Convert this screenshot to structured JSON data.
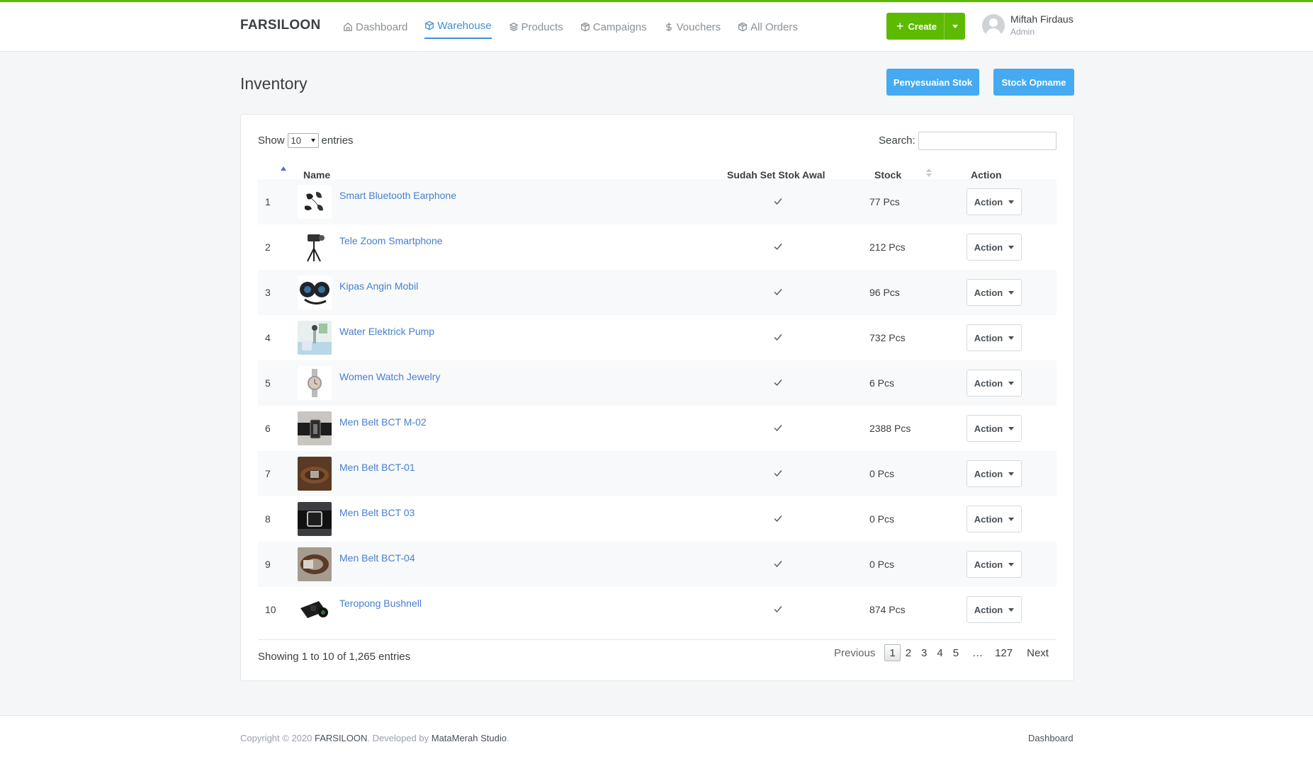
{
  "brand": "FARSILOON",
  "nav": [
    {
      "label": "Dashboard",
      "icon": "home-icon",
      "active": false
    },
    {
      "label": "Warehouse",
      "icon": "box-icon",
      "active": true
    },
    {
      "label": "Products",
      "icon": "layers-icon",
      "active": false
    },
    {
      "label": "Campaigns",
      "icon": "package-icon",
      "active": false
    },
    {
      "label": "Vouchers",
      "icon": "dollar-icon",
      "active": false
    },
    {
      "label": "All Orders",
      "icon": "package-icon",
      "active": false
    }
  ],
  "header": {
    "create_label": "Create",
    "user_name": "Miftah Firdaus",
    "user_role": "Admin"
  },
  "page": {
    "title": "Inventory",
    "btn_adjust": "Penyesuaian Stok",
    "btn_opname": "Stock Opname"
  },
  "table": {
    "show_label": "Show",
    "entries_value": "10",
    "entries_label": "entries",
    "search_label": "Search:",
    "search_value": "",
    "columns": {
      "name": "Name",
      "stok_awal": "Sudah Set Stok Awal",
      "stock": "Stock",
      "action": "Action"
    },
    "rows": [
      {
        "no": "1",
        "name": "Smart Bluetooth Earphone",
        "stock": "77 Pcs",
        "action": "Action"
      },
      {
        "no": "2",
        "name": "Tele Zoom Smartphone",
        "stock": "212 Pcs",
        "action": "Action"
      },
      {
        "no": "3",
        "name": "Kipas Angin Mobil",
        "stock": "96 Pcs",
        "action": "Action"
      },
      {
        "no": "4",
        "name": "Water Elektrick Pump",
        "stock": "732 Pcs",
        "action": "Action"
      },
      {
        "no": "5",
        "name": "Women Watch Jewelry",
        "stock": "6 Pcs",
        "action": "Action"
      },
      {
        "no": "6",
        "name": "Men Belt BCT M-02",
        "stock": "2388 Pcs",
        "action": "Action"
      },
      {
        "no": "7",
        "name": "Men Belt BCT-01",
        "stock": "0 Pcs",
        "action": "Action"
      },
      {
        "no": "8",
        "name": "Men Belt BCT 03",
        "stock": "0 Pcs",
        "action": "Action"
      },
      {
        "no": "9",
        "name": "Men Belt BCT-04",
        "stock": "0 Pcs",
        "action": "Action"
      },
      {
        "no": "10",
        "name": "Teropong Bushnell",
        "stock": "874 Pcs",
        "action": "Action"
      }
    ],
    "showing_text": "Showing 1 to 10 of 1,265 entries",
    "pagination": {
      "previous": "Previous",
      "pages": [
        "1",
        "2",
        "3",
        "4",
        "5"
      ],
      "ellipsis": "…",
      "last": "127",
      "next": "Next"
    }
  },
  "footer": {
    "copy_prefix": "Copyright © 2020 ",
    "copy_brand": "FARSILOON",
    "copy_mid": ". Developed by ",
    "copy_dev": "MataMerah Studio",
    "copy_end": ".",
    "link": "Dashboard"
  },
  "colors": {
    "accent_green": "#5eba00",
    "accent_blue": "#45aaf2",
    "link_blue": "#467fcf"
  }
}
